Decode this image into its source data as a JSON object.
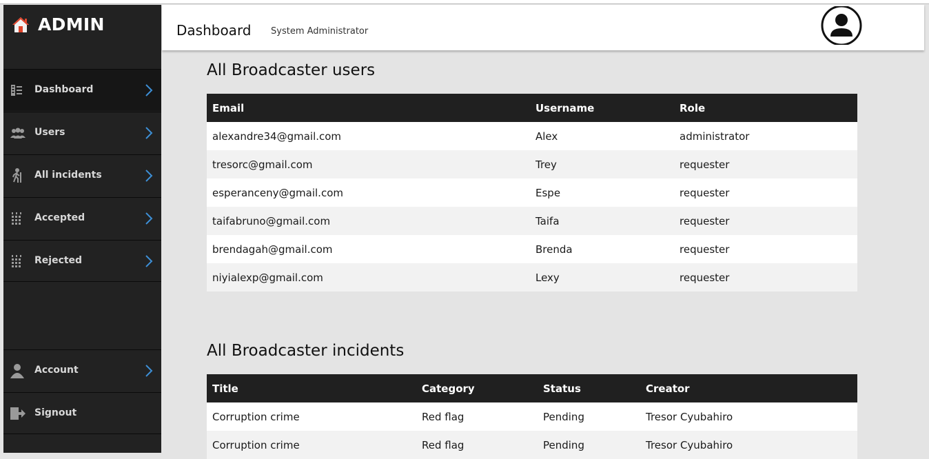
{
  "sidebar": {
    "brand": "ADMIN",
    "items": [
      {
        "label": "Dashboard",
        "icon": "dashboard-icon"
      },
      {
        "label": "Users",
        "icon": "users-icon"
      },
      {
        "label": "All incidents",
        "icon": "incidents-icon"
      },
      {
        "label": "Accepted",
        "icon": "calendar-icon"
      },
      {
        "label": "Rejected",
        "icon": "calendar-icon"
      },
      {
        "label": "Account",
        "icon": "account-icon"
      },
      {
        "label": "Signout",
        "icon": "signout-icon"
      }
    ]
  },
  "header": {
    "title": "Dashboard",
    "subtitle": "System Administrator"
  },
  "users_section": {
    "title": "All Broadcaster users",
    "columns": [
      "Email",
      "Username",
      "Role"
    ],
    "rows": [
      [
        "alexandre34@gmail.com",
        "Alex",
        "administrator"
      ],
      [
        "tresorc@gmail.com",
        "Trey",
        "requester"
      ],
      [
        "esperanceny@gmail.com",
        "Espe",
        "requester"
      ],
      [
        "taifabruno@gmail.com",
        "Taifa",
        "requester"
      ],
      [
        "brendagah@gmail.com",
        "Brenda",
        "requester"
      ],
      [
        "niyialexp@gmail.com",
        "Lexy",
        "requester"
      ]
    ]
  },
  "incidents_section": {
    "title": "All Broadcaster incidents",
    "columns": [
      "Title",
      "Category",
      "Status",
      "Creator"
    ],
    "rows": [
      [
        "Corruption crime",
        "Red flag",
        "Pending",
        "Tresor Cyubahiro"
      ],
      [
        "Corruption crime",
        "Red flag",
        "Pending",
        "Tresor Cyubahiro"
      ]
    ]
  },
  "colors": {
    "sidebar_bg": "#222222",
    "accent_chevron": "#3d8fd6",
    "table_header_bg": "#202020",
    "page_bg": "#e4e4e4"
  }
}
